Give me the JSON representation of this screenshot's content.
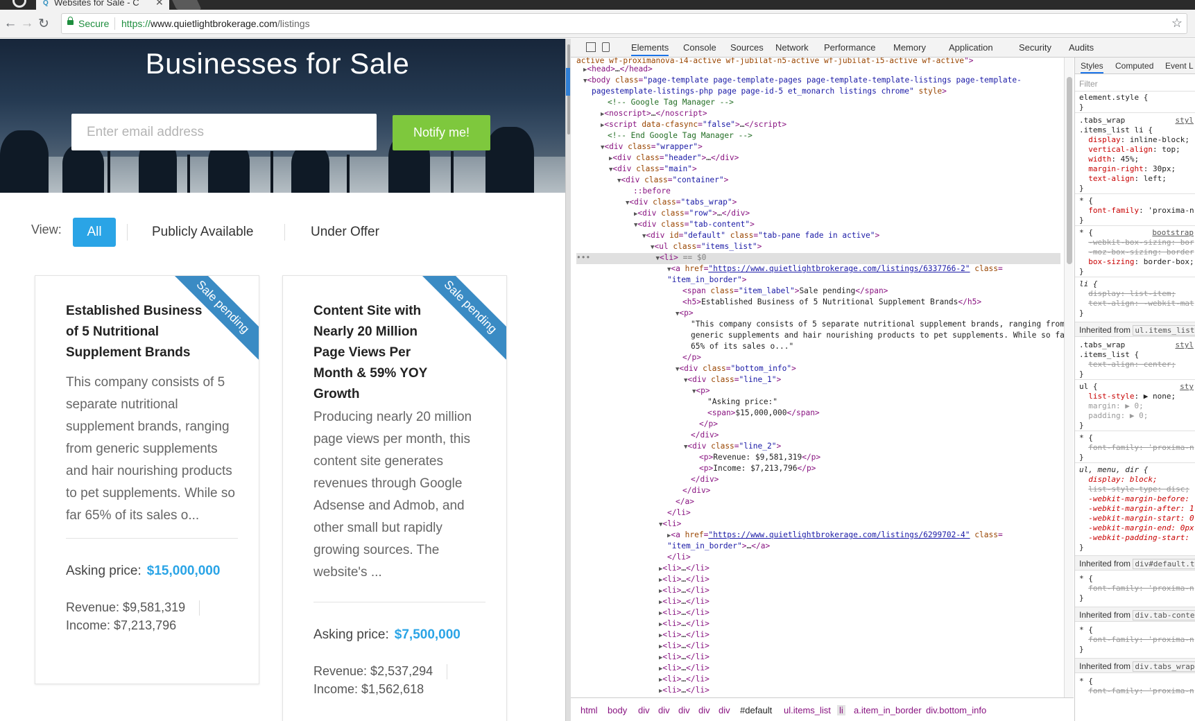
{
  "browser": {
    "tab_title": "Websites for Sale - C",
    "tab_close": "✕",
    "secure_label": "Secure",
    "url_proto": "https://",
    "url_host": "www.quietlightbrokerage.com",
    "url_path": "/listings"
  },
  "site": {
    "hero_title": "Businesses for Sale",
    "email_placeholder": "Enter email address",
    "notify_label": "Notify me!",
    "view_label": "View:",
    "view_tabs": [
      "All",
      "Publicly Available",
      "Under Offer"
    ],
    "accent_color": "#2aa4e6",
    "notify_color": "#7ec83d",
    "listings": [
      {
        "ribbon": "Sale pending",
        "title": "Established Business of 5 Nutritional Supplement Brands",
        "description": "This company consists of 5 separate nutritional supplement brands, ranging from generic supplements and hair nourishing products to pet supplements. While so far 65% of its sales o...",
        "asking_label": "Asking price:",
        "asking_price": "$15,000,000",
        "revenue": "Revenue: $9,581,319",
        "income": "Income: $7,213,796"
      },
      {
        "ribbon": "Sale pending",
        "title": "Content Site with Nearly 20 Million Page Views Per Month & 59% YOY Growth",
        "description": "Producing nearly 20 million page views per month, this content site generates revenues through Google Adsense and Admob, and other small but rapidly growing sources. The website's ...",
        "asking_label": "Asking price:",
        "asking_price": "$7,500,000",
        "revenue": "Revenue: $2,537,294",
        "income": "Income: $1,562,618"
      }
    ]
  },
  "devtools": {
    "tabs": [
      "Elements",
      "Console",
      "Sources",
      "Network",
      "Performance",
      "Memory",
      "Application",
      "Security",
      "Audits"
    ],
    "breadcrumbs": [
      "html",
      "body",
      "div",
      "div",
      "div",
      "div",
      "div",
      "#default",
      "ul.items_list",
      "li",
      "a.item_in_border",
      "div.bottom_info"
    ],
    "styles_tabs": [
      "Styles",
      "Computed",
      "Event L"
    ],
    "filter_placeholder": "Filter",
    "inherited": [
      "Inherited from",
      "ul.items_list",
      "div#default.t",
      "div.tab-conte",
      "div.tabs_wrap"
    ]
  }
}
